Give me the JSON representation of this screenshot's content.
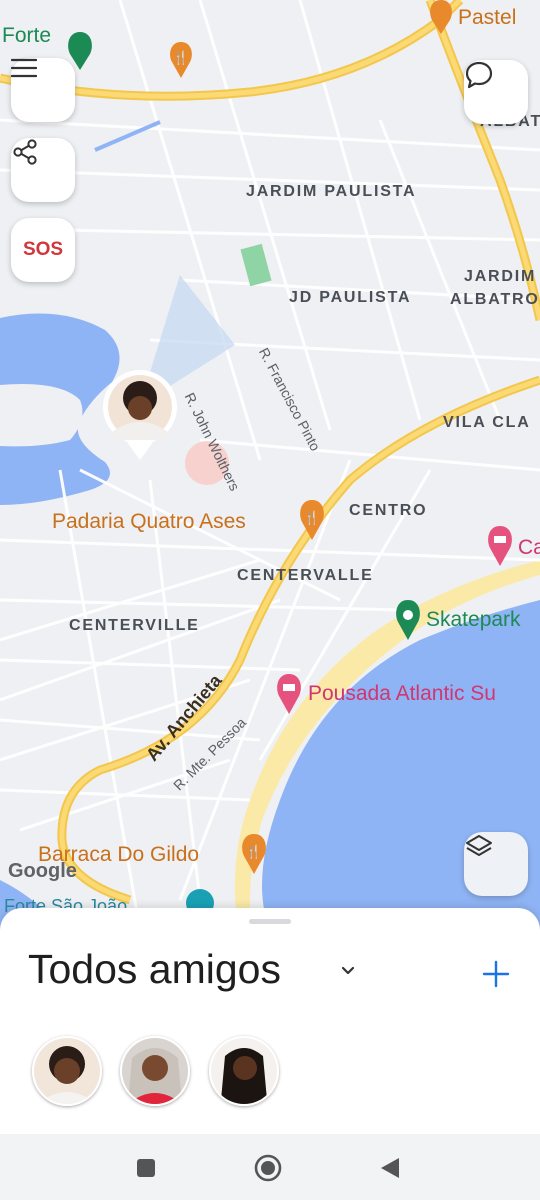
{
  "map": {
    "labels": {
      "forte": "Forte",
      "pastel": "Pastel",
      "albatross_partial": "ALBAT",
      "jardim_paulista": "JARDIM PAULISTA",
      "jardim_partial": "JARDIM",
      "albatross2_partial": "ALBATRO",
      "jd_paulista": "JD PAULISTA",
      "rua_john": "R. John Wolthers",
      "rua_francisco": "R. Francisco Pinto",
      "vila_partial": "VILA CLA",
      "padaria": "Padaria Quatro Ases",
      "centro": "CENTRO",
      "ca_partial": "Ca",
      "centervalle": "CENTERVALLE",
      "centerville": "CENTERVILLE",
      "skatepark": "Skatepark",
      "pousada": "Pousada Atlantic Su",
      "av_anchieta": "Av. Anchieta",
      "rua_mte": "R. Mte. Pessoa",
      "barraca": "Barraca Do Gildo",
      "google": "Google",
      "forte_sao_partial": "Forte São João"
    },
    "icons": [
      "menu-icon",
      "share-icon",
      "chat-bubble-icon",
      "layers-icon",
      "restaurant-pin-icon",
      "hotel-pin-icon",
      "park-pin-icon"
    ],
    "sos_label": "SOS"
  },
  "sheet": {
    "title": "Todos amigos",
    "friend_count_shown": 3
  },
  "colors": {
    "water": "#8fb4f5",
    "highway": "#f2c74b",
    "beach": "#fbe9a8",
    "accent": "#1a73e8"
  }
}
